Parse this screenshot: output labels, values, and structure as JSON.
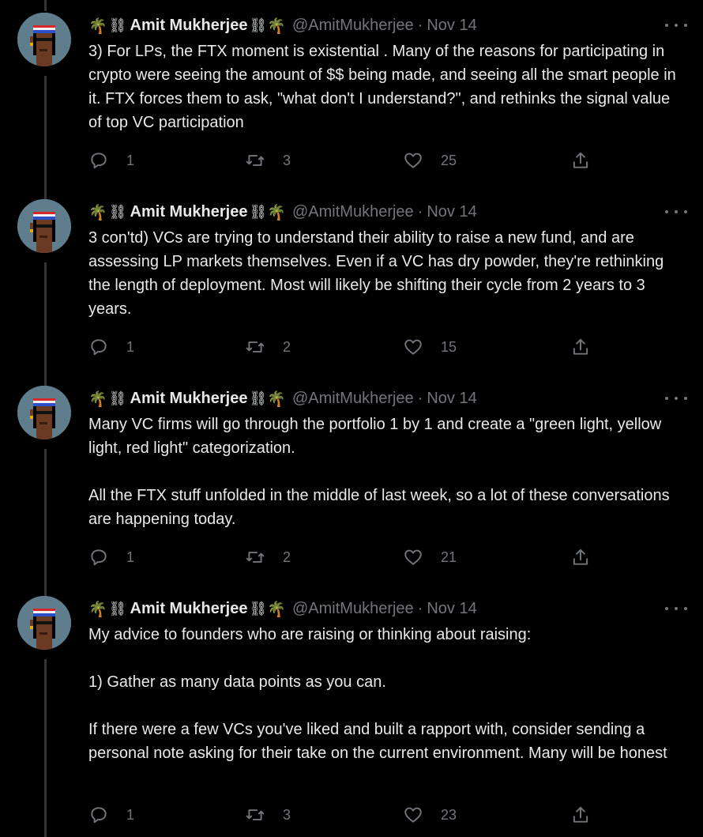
{
  "tweets": [
    {
      "author": "Amit Mukherjee",
      "handle": "@AmitMukherjee",
      "date": "Nov 14",
      "emoji_left": "🌴",
      "emoji_right": "🌴",
      "dna_left": "⛓",
      "dna_right": "⛓",
      "paragraphs": [
        "3) For LPs, the FTX moment is existential . Many of the reasons for participating in crypto were seeing the amount of $$ being made, and seeing all the smart people in it. FTX forces them to ask, \"what don't I understand?\", and rethinks the signal value of top VC participation"
      ],
      "replies": "1",
      "retweets": "3",
      "likes": "25"
    },
    {
      "author": "Amit Mukherjee",
      "handle": "@AmitMukherjee",
      "date": "Nov 14",
      "emoji_left": "🌴",
      "emoji_right": "🌴",
      "dna_left": "⛓",
      "dna_right": "⛓",
      "paragraphs": [
        "3 con'td) VCs are trying to understand their ability to raise a new fund, and are assessing LP markets themselves. Even if a VC has dry powder, they're rethinking the length of deployment. Most will likely be shifting their cycle from 2 years to 3 years."
      ],
      "replies": "1",
      "retweets": "2",
      "likes": "15"
    },
    {
      "author": "Amit Mukherjee",
      "handle": "@AmitMukherjee",
      "date": "Nov 14",
      "emoji_left": "🌴",
      "emoji_right": "🌴",
      "dna_left": "⛓",
      "dna_right": "⛓",
      "paragraphs": [
        "Many VC firms will go through the portfolio 1 by 1 and create a \"green light, yellow light, red light\" categorization.",
        "",
        "All the FTX stuff unfolded in the middle  of last week, so a lot of these conversations are happening today."
      ],
      "replies": "1",
      "retweets": "2",
      "likes": "21"
    },
    {
      "author": "Amit Mukherjee",
      "handle": "@AmitMukherjee",
      "date": "Nov 14",
      "emoji_left": "🌴",
      "emoji_right": "🌴",
      "dna_left": "⛓",
      "dna_right": "⛓",
      "paragraphs": [
        "My advice to founders who are raising or thinking about raising:",
        "",
        "1) Gather as many data points as you can.",
        "",
        "If there were a few VCs you've liked and built a rapport with, consider sending a personal note asking for their take on the current environment. Many will be honest"
      ],
      "replies": "1",
      "retweets": "3",
      "likes": "23"
    }
  ],
  "icons": {
    "reply": "reply-icon",
    "retweet": "retweet-icon",
    "like": "heart-icon",
    "share": "share-icon",
    "more": "more-icon",
    "avatar": "pixel-avatar"
  },
  "colors": {
    "background": "#000000",
    "text": "#e7e9ea",
    "muted": "#71767b",
    "thread_line": "#333639"
  }
}
